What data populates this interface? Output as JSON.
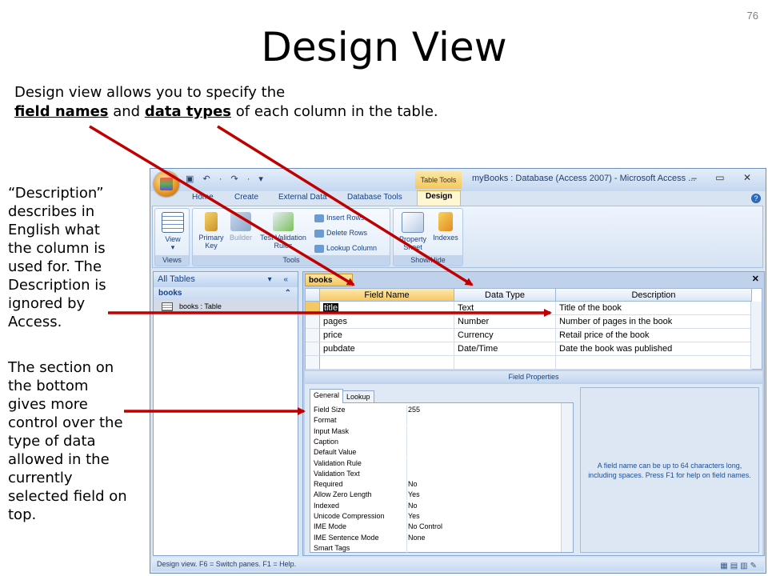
{
  "slide": {
    "number": "76",
    "title": "Design View",
    "intro_line1": "Design view allows you to specify the",
    "intro_field_names": "field names",
    "intro_and": " and ",
    "intro_data_types": "data types",
    "intro_rest": " of each column in the table.",
    "side_description": "“Description” describes in English what the column is used for. The Description is ignored by Access.",
    "side_section": "The section on the bottom gives more control over the type of data allowed in the currently selected field on top."
  },
  "window": {
    "context_tab": "Table Tools",
    "title": "myBooks : Database (Access 2007) - Microsoft Access ...",
    "qat": "▣ ↶ · ↷ · ▾",
    "controls": "– ▭ ✕",
    "tabs": [
      "Home",
      "Create",
      "External Data",
      "Database Tools",
      "Design"
    ],
    "help": "?"
  },
  "ribbon": {
    "groups": [
      "Views",
      "Tools",
      "Show/Hide"
    ],
    "view_label": "View",
    "view_sub": "▾",
    "primary_key_label": "Primary Key",
    "builder_label": "Builder",
    "test_validation_label": "Test Validation Rules",
    "insert_rows": "Insert Rows",
    "delete_rows": "Delete Rows",
    "lookup_column": "Lookup Column",
    "property_sheet": "Property Sheet",
    "indexes": "Indexes"
  },
  "nav": {
    "header": "All Tables",
    "header_ctl": "▾ «",
    "group": "books",
    "group_ctl": "⌃",
    "item": "books : Table"
  },
  "doc": {
    "tab": "books",
    "close": "✕",
    "columns": [
      "Field Name",
      "Data Type",
      "Description"
    ],
    "rows": [
      {
        "name": "title",
        "type": "Text",
        "desc": "Title of the book"
      },
      {
        "name": "pages",
        "type": "Number",
        "desc": "Number of pages in the book"
      },
      {
        "name": "price",
        "type": "Currency",
        "desc": "Retail price of the book"
      },
      {
        "name": "pubdate",
        "type": "Date/Time",
        "desc": "Date the book was published"
      }
    ],
    "field_properties": "Field Properties",
    "prop_tabs": [
      "General",
      "Lookup"
    ],
    "properties": [
      {
        "k": "Field Size",
        "v": "255"
      },
      {
        "k": "Format",
        "v": ""
      },
      {
        "k": "Input Mask",
        "v": ""
      },
      {
        "k": "Caption",
        "v": ""
      },
      {
        "k": "Default Value",
        "v": ""
      },
      {
        "k": "Validation Rule",
        "v": ""
      },
      {
        "k": "Validation Text",
        "v": ""
      },
      {
        "k": "Required",
        "v": "No"
      },
      {
        "k": "Allow Zero Length",
        "v": "Yes"
      },
      {
        "k": "Indexed",
        "v": "No"
      },
      {
        "k": "Unicode Compression",
        "v": "Yes"
      },
      {
        "k": "IME Mode",
        "v": "No Control"
      },
      {
        "k": "IME Sentence Mode",
        "v": "None"
      },
      {
        "k": "Smart Tags",
        "v": ""
      }
    ],
    "hint": "A field name can be up to 64 characters long, including spaces. Press F1 for help on field names."
  },
  "status": {
    "text": "Design view.  F6 = Switch panes.  F1 = Help.",
    "views": "▦▤▥✎"
  },
  "colors": {
    "arrow": "#c00000",
    "accent": "#f6c765"
  }
}
